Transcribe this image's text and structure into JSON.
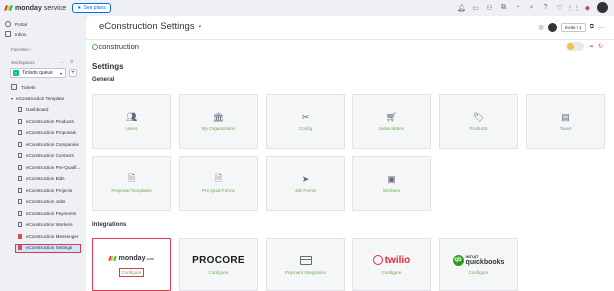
{
  "topbar": {
    "brand": "monday",
    "brand_suffix": "service",
    "see_plans": "See plans",
    "avatar_initial": ""
  },
  "sidebar": {
    "nav": [
      {
        "label": "Portal",
        "icon": "portal-icon"
      },
      {
        "label": "Inbox",
        "icon": "inbox-icon"
      }
    ],
    "favorites_label": "Favorites",
    "workspaces_label": "Workspaces",
    "workspace_name": "Tickets queue",
    "workspace_initial": "T",
    "tickets_label": "Tickets",
    "template_label": "eConstruction Template",
    "items": [
      "Dashboard",
      "eConstruction Products",
      "eConstruction Proposals",
      "eConstruction Companies",
      "eConstruction Contacts",
      "eConstruction Pre-Qualif...",
      "eConstruction Bids",
      "eConstruction Projects",
      "eConstruction Jobs",
      "eConstruction Payments",
      "eConstruction Workers",
      "eConstruction Messenger",
      "eConstruction Settings"
    ]
  },
  "header": {
    "title": "eConstruction Settings",
    "invite": "Invite / 1"
  },
  "app": {
    "brand": "construction",
    "settings_title": "Settings",
    "general_label": "General",
    "integrations_label": "Integrations",
    "general_cards": [
      {
        "label": "Users",
        "icon": "users-icon"
      },
      {
        "label": "My Organization",
        "icon": "organization-icon"
      },
      {
        "label": "Config",
        "icon": "tools-icon"
      },
      {
        "label": "Subscription",
        "icon": "cart-icon"
      },
      {
        "label": "Products",
        "icon": "tag-icon"
      },
      {
        "label": "Taxes",
        "icon": "taxes-icon"
      },
      {
        "label": "Proposal Templates",
        "icon": "proposal-doc-icon"
      },
      {
        "label": "Pre-Qual Forms",
        "icon": "form-doc-icon"
      },
      {
        "label": "Job Forms",
        "icon": "send-icon"
      },
      {
        "label": "Workers",
        "icon": "worker-badge-icon"
      }
    ],
    "integrations": [
      {
        "logo_text": "monday",
        "logo_suffix": ".com",
        "label": "Configure"
      },
      {
        "logo_text": "PROCORE",
        "label": "Configure"
      },
      {
        "logo_text": "",
        "label": "Payment Integration"
      },
      {
        "logo_text": "twilio",
        "label": "Configure"
      },
      {
        "logo_top": "INTUIT",
        "logo_text": "quickbooks",
        "label": "Configure"
      }
    ]
  },
  "colors": {
    "accent": "#0073ea",
    "card_label": "#6aa84f",
    "highlight": "#d83a52"
  }
}
